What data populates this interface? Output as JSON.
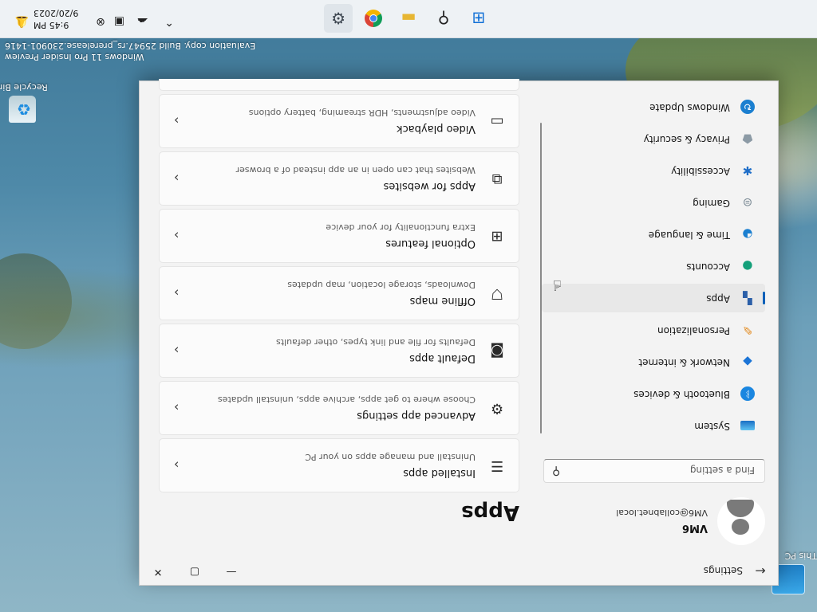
{
  "desktop": {
    "icons": [
      {
        "label": "This PC"
      },
      {
        "label": "Recycle Bin"
      }
    ],
    "watermark": {
      "line1": "Windows 11 Pro Insider Preview",
      "line2": "Evaluation copy. Build 25947.rs_prerelease.230901-1416"
    }
  },
  "window": {
    "title": "Settings",
    "controls": {
      "minimize": "—",
      "maximize": "▢",
      "close": "✕"
    },
    "user": {
      "name": "VM6",
      "email": "VM6@collabnet.local"
    },
    "search": {
      "placeholder": "Find a setting"
    },
    "nav": [
      {
        "label": "System",
        "icon": "system-icon"
      },
      {
        "label": "Bluetooth & devices",
        "icon": "bluetooth-icon"
      },
      {
        "label": "Network & internet",
        "icon": "network-icon"
      },
      {
        "label": "Personalization",
        "icon": "brush-icon"
      },
      {
        "label": "Apps",
        "icon": "apps-icon",
        "active": true
      },
      {
        "label": "Accounts",
        "icon": "accounts-icon"
      },
      {
        "label": "Time & language",
        "icon": "globe-icon"
      },
      {
        "label": "Gaming",
        "icon": "gamepad-icon"
      },
      {
        "label": "Accessibility",
        "icon": "accessibility-icon"
      },
      {
        "label": "Privacy & security",
        "icon": "shield-icon"
      },
      {
        "label": "Windows Update",
        "icon": "update-icon"
      }
    ],
    "page_title": "Apps",
    "cards": [
      {
        "title": "Installed apps",
        "subtitle": "Uninstall and manage apps on your PC",
        "icon": "list-icon"
      },
      {
        "title": "Advanced app settings",
        "subtitle": "Choose where to get apps, archive apps, uninstall updates",
        "icon": "app-settings-icon"
      },
      {
        "title": "Default apps",
        "subtitle": "Defaults for file and link types, other defaults",
        "icon": "default-apps-icon"
      },
      {
        "title": "Offline maps",
        "subtitle": "Downloads, storage location, map updates",
        "icon": "map-icon"
      },
      {
        "title": "Optional features",
        "subtitle": "Extra functionality for your device",
        "icon": "grid-plus-icon"
      },
      {
        "title": "Apps for websites",
        "subtitle": "Websites that can open in an app instead of a browser",
        "icon": "open-in-app-icon"
      },
      {
        "title": "Video playback",
        "subtitle": "Video adjustments, HDR streaming, battery options",
        "icon": "video-icon"
      }
    ]
  },
  "taskbar": {
    "apps": [
      "start-icon",
      "search-icon",
      "file-explorer-icon",
      "chrome-icon",
      "settings-icon"
    ],
    "clock": {
      "time": "9:45 PM",
      "date": "9/20/2023"
    }
  },
  "colors": {
    "accent": "#005fb8",
    "window_bg": "#f3f3f3",
    "card_bg": "#fbfbfb"
  }
}
